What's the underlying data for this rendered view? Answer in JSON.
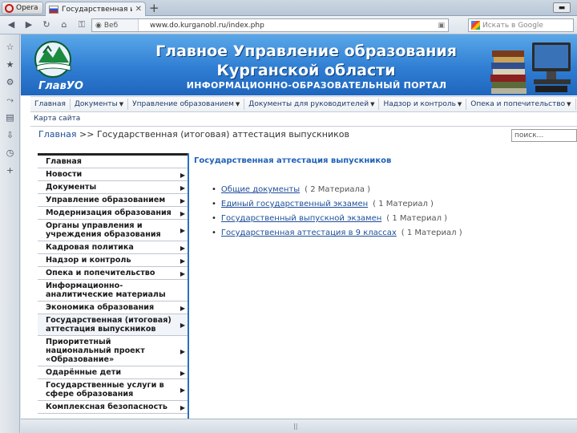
{
  "browser": {
    "menu_label": "Opera",
    "tab_title": "Государственная ит...",
    "tab_close": "✕",
    "new_tab": "+",
    "site_badge": "Веб",
    "url": "www.do.kurganobl.ru/index.php",
    "search_placeholder": "Искать в Google"
  },
  "banner": {
    "logo_text": "ГлавУО",
    "title_line1": "Главное Управление образования",
    "title_line2": "Курганской области",
    "subtitle": "ИНФОРМАЦИОННО-ОБРАЗОВАТЕЛЬНЫЙ ПОРТАЛ"
  },
  "main_menu": [
    {
      "label": "Главная",
      "has_arrow": false
    },
    {
      "label": "Документы",
      "has_arrow": true
    },
    {
      "label": "Управление образованием",
      "has_arrow": true
    },
    {
      "label": "Документы для руководителей",
      "has_arrow": true
    },
    {
      "label": "Надзор и контроль",
      "has_arrow": true
    },
    {
      "label": "Опека и попечительство",
      "has_arrow": true
    }
  ],
  "site_map": "Карта сайта",
  "breadcrumb": {
    "home": "Главная",
    "separator": " >> ",
    "current": "Государственная (итоговая) аттестация выпускников"
  },
  "site_search_value": "поиск...",
  "side_menu": [
    {
      "label": "Главная",
      "has_arrow": false
    },
    {
      "label": "Новости",
      "has_arrow": true
    },
    {
      "label": "Документы",
      "has_arrow": true
    },
    {
      "label": "Управление образованием",
      "has_arrow": true
    },
    {
      "label": "Модернизация образования",
      "has_arrow": true
    },
    {
      "label": "Органы управления и учреждения образования",
      "has_arrow": true
    },
    {
      "label": "Кадровая политика",
      "has_arrow": true
    },
    {
      "label": "Надзор и контроль",
      "has_arrow": true
    },
    {
      "label": "Опека и попечительство",
      "has_arrow": true
    },
    {
      "label": "Информационно-аналитические материалы",
      "has_arrow": false
    },
    {
      "label": "Экономика образования",
      "has_arrow": true
    },
    {
      "label": "Государственная (итоговая) аттестация выпускников",
      "has_arrow": true
    },
    {
      "label": "Приоритетный национальный проект «Образование»",
      "has_arrow": true
    },
    {
      "label": "Одарённые дети",
      "has_arrow": true
    },
    {
      "label": "Государственные услуги в сфере образования",
      "has_arrow": true
    },
    {
      "label": "Комплексная безопасность",
      "has_arrow": true
    }
  ],
  "content": {
    "title": "Государственная аттестация выпускников",
    "items": [
      {
        "label": "Общие документы",
        "count": "( 2 Материала )"
      },
      {
        "label": "Единый государственный экзамен",
        "count": "( 1 Материал )"
      },
      {
        "label": "Государственный выпускной экзамен",
        "count": "( 1 Материал )"
      },
      {
        "label": "Государственная аттестация в 9 классах",
        "count": "( 1 Материал )"
      }
    ]
  },
  "status_grip": "||"
}
